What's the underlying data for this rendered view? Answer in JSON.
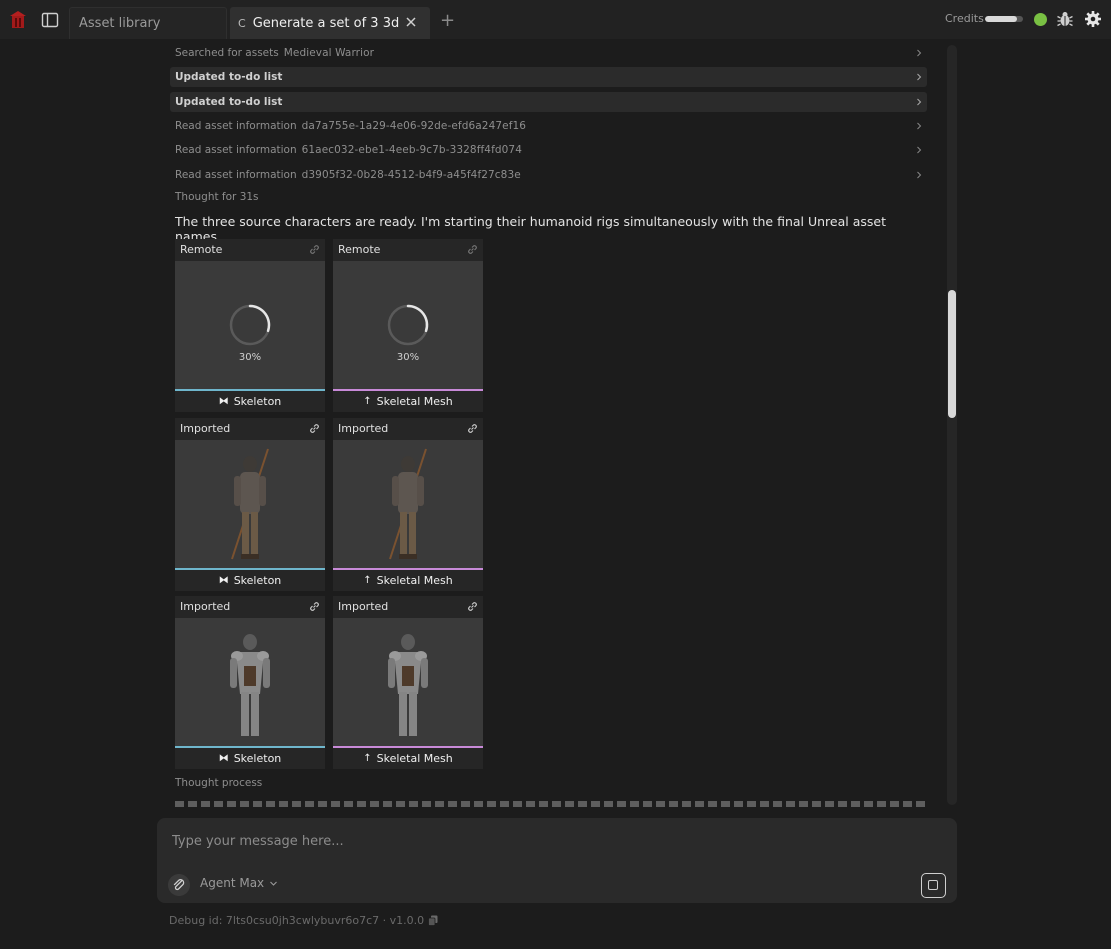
{
  "tabs": [
    {
      "label": "Asset library"
    },
    {
      "label": "Generate a set of 3 3d ..."
    }
  ],
  "header": {
    "credits_label": "Credits",
    "credits_fraction": 0.85,
    "status_color": "#79c043"
  },
  "activity": [
    {
      "label": "Searched for assets",
      "value": "Medieval Warrior"
    },
    {
      "label": "Updated to-do list",
      "value": ""
    },
    {
      "label": "Updated to-do list",
      "value": ""
    },
    {
      "label": "Read asset information",
      "value": "da7a755e-1a29-4e06-92de-efd6a247ef16"
    },
    {
      "label": "Read asset information",
      "value": "61aec032-ebe1-4eeb-9c7b-3328ff4fd074"
    },
    {
      "label": "Read asset information",
      "value": "d3905f32-0b28-4512-b4f9-a45f4f27c83e"
    }
  ],
  "thought_label": "Thought for 31s",
  "message": "The three source characters are ready. I'm starting their humanoid rigs simultaneously with the final Unreal asset names.",
  "cards": [
    {
      "status": "Remote",
      "type": "Skeleton",
      "progress": "30%",
      "accent": "#6fb6cc",
      "figure": "none"
    },
    {
      "status": "Remote",
      "type": "Skeletal Mesh",
      "progress": "30%",
      "accent": "#c88ad8",
      "figure": "none"
    },
    {
      "status": "Imported",
      "type": "Skeleton",
      "progress": "",
      "accent": "#6fb6cc",
      "figure": "peasant"
    },
    {
      "status": "Imported",
      "type": "Skeletal Mesh",
      "progress": "",
      "accent": "#c88ad8",
      "figure": "peasant"
    },
    {
      "status": "Imported",
      "type": "Skeleton",
      "progress": "",
      "accent": "#6fb6cc",
      "figure": "knight"
    },
    {
      "status": "Imported",
      "type": "Skeletal Mesh",
      "progress": "",
      "accent": "#c88ad8",
      "figure": "knight"
    }
  ],
  "thought_process_label": "Thought process",
  "composer": {
    "placeholder": "Type your message here...",
    "agent": "Agent Max"
  },
  "footer": {
    "debug": "Debug id: 7lts0csu0jh3cwlybuvr6o7c7 · v1.0.0"
  }
}
